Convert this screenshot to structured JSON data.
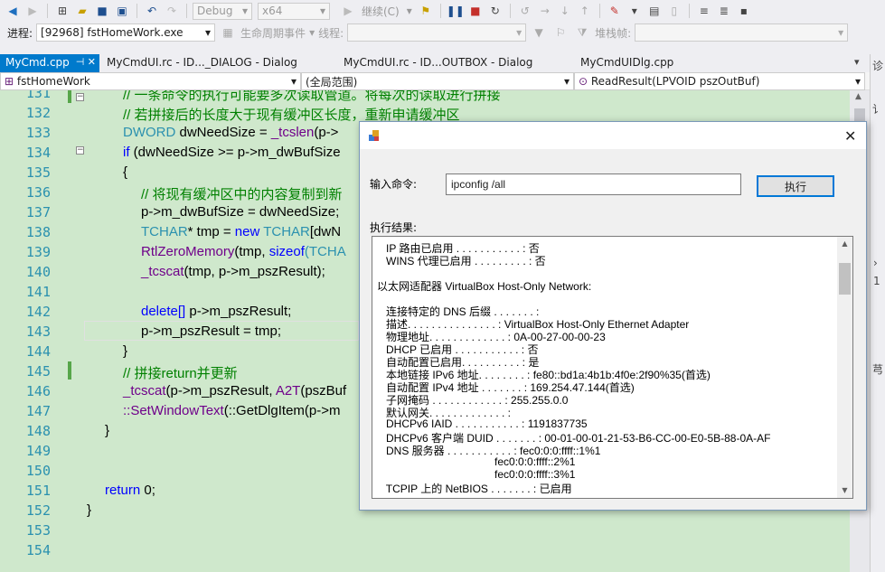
{
  "toolbar1": {
    "config_label": "Debug",
    "platform_label": "x64",
    "continue_label": "继续(C)"
  },
  "toolbar2": {
    "process_label": "进程:",
    "process_value": "[92968] fstHomeWork.exe",
    "lifecycle_label": "生命周期事件",
    "thread_label": "线程:",
    "stackframe_label": "堆栈帧:"
  },
  "tabs": [
    {
      "label": "MyCmd.cpp",
      "active": true
    },
    {
      "label": "MyCmdUI.rc - ID..._DIALOG - Dialog"
    },
    {
      "label": "MyCmdUI.rc - ID...OUTBOX - Dialog"
    },
    {
      "label": "MyCmdUIDlg.cpp"
    }
  ],
  "navbar": {
    "project": "fstHomeWork",
    "scope": "(全局范围)",
    "function": "ReadResult(LPVOID pszOutBuf)"
  },
  "rightpanel": {
    "label1": "诊",
    "label2": "讠"
  },
  "line_numbers": [
    "131",
    "132",
    "133",
    "134",
    "135",
    "136",
    "137",
    "138",
    "139",
    "140",
    "141",
    "142",
    "143",
    "144",
    "145",
    "146",
    "147",
    "148",
    "149",
    "150",
    "151",
    "152",
    "153",
    "154"
  ],
  "code": {
    "l131": "// 一条命令的执行可能要多次读取管道。将每次的读取进行拼接",
    "l132": "// 若拼接后的长度大于现有缓冲区长度，重新申请缓冲区",
    "l133_type": "DWORD",
    "l133_rest": " dwNeedSize = ",
    "l133_fn": "_tcslen",
    "l133_tail": "(p->",
    "l134_kw": "if",
    "l134_rest": " (dwNeedSize >= p->m_dwBufSize",
    "l135": "{",
    "l136": "// 将现有缓冲区中的内容复制到新",
    "l137": "p->m_dwBufSize = dwNeedSize;",
    "l138_type": "TCHAR",
    "l138_rest": "* tmp = ",
    "l138_kw": "new",
    "l138_type2": " TCHAR",
    "l138_tail": "[dwN",
    "l139_fn": "RtlZeroMemory",
    "l139_rest": "(tmp, ",
    "l139_kw": "sizeof",
    "l139_tail": "(TCHA",
    "l140_fn": "_tcscat",
    "l140_rest": "(tmp, p->m_pszResult);",
    "l142_kw": "delete[]",
    "l142_rest": " p->m_pszResult;",
    "l143": "p->m_pszResult = tmp;",
    "l144": "}",
    "l145": "// 拼接return并更新",
    "l146_fn": "_tcscat",
    "l146_rest": "(p->m_pszResult, ",
    "l146_mac": "A2T",
    "l146_tail": "(pszBuf",
    "l147_fn": "::SetWindowText",
    "l147_rest": "(::GetDlgItem(p->m",
    "l148": "}",
    "l151_kw": "return",
    "l151_rest": " 0;",
    "l152": "}"
  },
  "dialog": {
    "cmd_label": "输入命令:",
    "cmd_value": "ipconfig /all",
    "exec_button": "执行",
    "result_label": "执行结果:",
    "result_lines": [
      "   IP 路由已启用 . . . . . . . . . . . : 否",
      "   WINS 代理已启用 . . . . . . . . . : 否",
      "",
      "以太网适配器 VirtualBox Host-Only Network:",
      "",
      "   连接特定的 DNS 后缀 . . . . . . . :",
      "   描述. . . . . . . . . . . . . . . : VirtualBox Host-Only Ethernet Adapter",
      "   物理地址. . . . . . . . . . . . . : 0A-00-27-00-00-23",
      "   DHCP 已启用 . . . . . . . . . . . : 否",
      "   自动配置已启用. . . . . . . . . . : 是",
      "   本地链接 IPv6 地址. . . . . . . . : fe80::bd1a:4b1b:4f0e:2f90%35(首选)",
      "   自动配置 IPv4 地址 . . . . . . . : 169.254.47.144(首选)",
      "   子网掩码 . . . . . . . . . . . . : 255.255.0.0",
      "   默认网关. . . . . . . . . . . . . :",
      "   DHCPv6 IAID . . . . . . . . . . . : 1191837735",
      "   DHCPv6 客户端 DUID . . . . . . . : 00-01-00-01-21-53-B6-CC-00-E0-5B-88-0A-AF",
      "   DNS 服务器 . . . . . . . . . . . : fec0:0:0:ffff::1%1",
      "                                       fec0:0:0:ffff::2%1",
      "                                       fec0:0:0:ffff::3%1",
      "   TCPIP 上的 NetBIOS . . . . . . . : 已启用"
    ]
  }
}
